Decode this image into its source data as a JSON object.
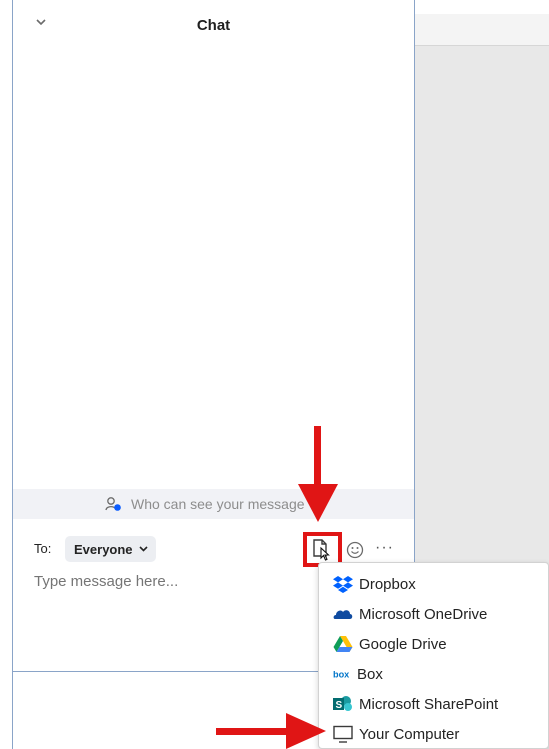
{
  "chat": {
    "title": "Chat",
    "who_can_see": "Who can see your message",
    "to_label": "To:",
    "recipient": "Everyone",
    "message_placeholder": "Type message here...",
    "more_label": "···"
  },
  "share_menu": {
    "items": [
      {
        "label": "Dropbox",
        "icon": "dropbox-icon"
      },
      {
        "label": "Microsoft OneDrive",
        "icon": "onedrive-icon"
      },
      {
        "label": "Google Drive",
        "icon": "google-drive-icon"
      },
      {
        "label": "Box",
        "icon": "box-icon"
      },
      {
        "label": "Microsoft SharePoint",
        "icon": "sharepoint-icon"
      },
      {
        "label": "Your Computer",
        "icon": "computer-icon"
      }
    ]
  },
  "colors": {
    "annotation_red": "#e01515",
    "dropbox_blue": "#0061fe",
    "onedrive_blue": "#0f4ba0",
    "box_blue": "#0075c9",
    "sharepoint_teal": "#036c70"
  }
}
